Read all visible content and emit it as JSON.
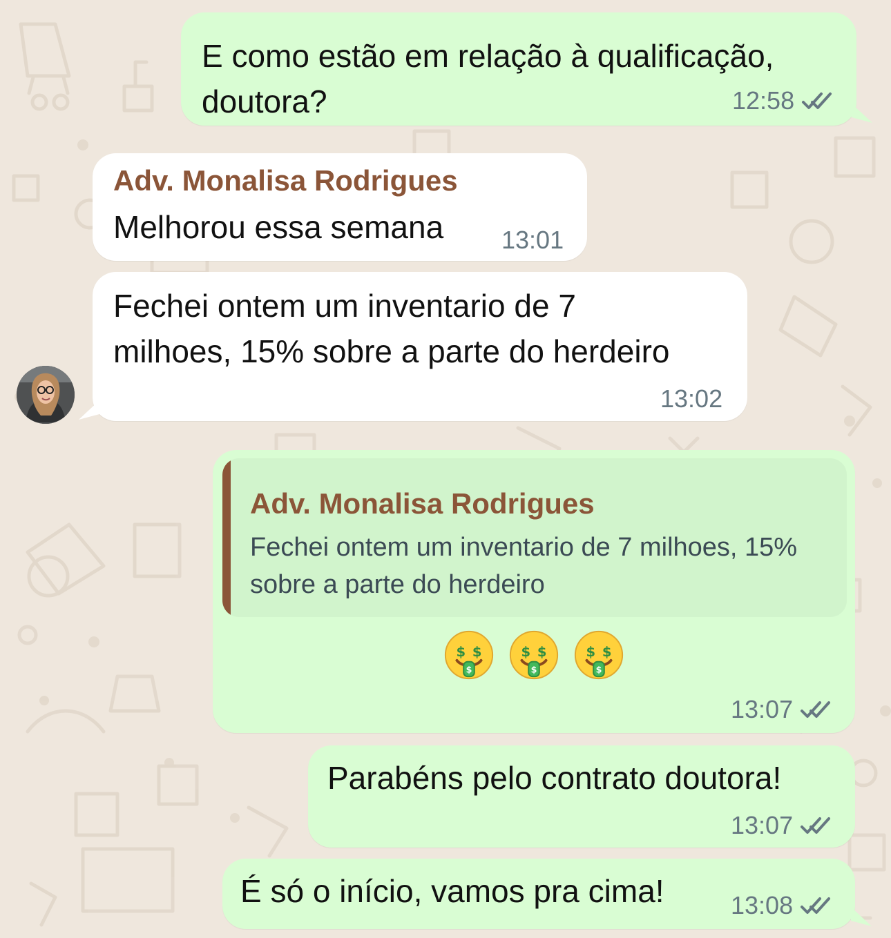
{
  "chat": {
    "messages": [
      {
        "direction": "outgoing",
        "text_line_1": "E como estão em relação à qualificação,",
        "text_line_2": "doutora?",
        "time": "12:58",
        "status": "read"
      },
      {
        "direction": "incoming",
        "sender": "Adv. Monalisa Rodrigues",
        "text": "Melhorou essa semana",
        "time": "13:01"
      },
      {
        "direction": "incoming",
        "text_line_1": "Fechei ontem um inventario de 7",
        "text_line_2": "milhoes, 15% sobre a parte do herdeiro",
        "time": "13:02"
      },
      {
        "direction": "outgoing",
        "quoted_sender": "Adv. Monalisa Rodrigues",
        "quoted_text_line_1": "Fechei ontem um inventario de 7 milhoes, 15%",
        "quoted_text_line_2": "sobre a parte do herdeiro",
        "emojis": [
          "🤑",
          "🤑",
          "🤑"
        ],
        "time": "13:07",
        "status": "read"
      },
      {
        "direction": "outgoing",
        "text": "Parabéns pelo contrato doutora!",
        "time": "13:07",
        "status": "read"
      },
      {
        "direction": "outgoing",
        "text": "É só o início, vamos pra cima!",
        "time": "13:08",
        "status": "read"
      }
    ]
  },
  "icons": {
    "read_receipt": "double-check-icon",
    "avatar": "profile-photo",
    "emoji": "money-mouth-face-emoji"
  },
  "colors": {
    "wallpaper": "#efe7dd",
    "incoming_bubble": "#ffffff",
    "outgoing_bubble": "#d9fdd3",
    "quote_background": "#d1f4cc",
    "sender_name": "#8b5538",
    "timestamp": "#667781"
  }
}
